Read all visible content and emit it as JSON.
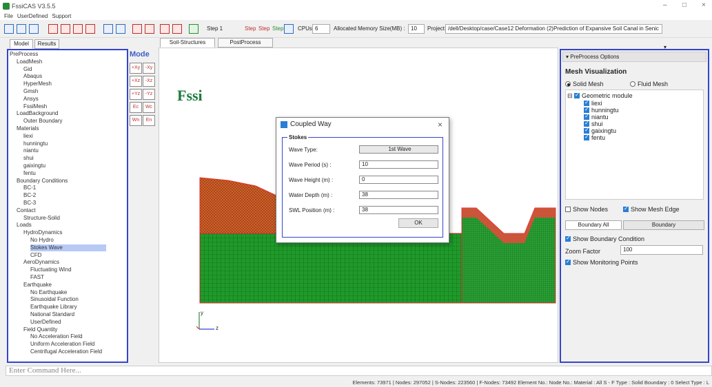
{
  "window": {
    "title": "FssiCAS V3.5.5"
  },
  "menu": [
    "File",
    "UserDefined",
    "Support"
  ],
  "toolbar": {
    "step": "Step 1",
    "step_labels": [
      "Step",
      "Step",
      "Step"
    ],
    "cpus_label": "CPUs",
    "cpus": "6",
    "mem_label": "Allocated Memory Size(MB) :",
    "mem": "10",
    "project_label": "Project:",
    "project": "/dell/Desktop/case/Case12 Deformation (2)Prediction of Expansive Soil Canal in Senic"
  },
  "left_tabs": [
    "Model",
    "Results"
  ],
  "view_tabs": [
    "Soil-Structures",
    "PostProcess"
  ],
  "tree": [
    {
      "t": "PreProcess",
      "d": 0
    },
    {
      "t": "LoadMesh",
      "d": 1
    },
    {
      "t": "Gid",
      "d": 2
    },
    {
      "t": "Abaqus",
      "d": 2
    },
    {
      "t": "HyperMesh",
      "d": 2
    },
    {
      "t": "Gmsh",
      "d": 2
    },
    {
      "t": "Ansys",
      "d": 2
    },
    {
      "t": "FssiMesh",
      "d": 2
    },
    {
      "t": "LoadBackground",
      "d": 1
    },
    {
      "t": "Outer Boundary",
      "d": 2
    },
    {
      "t": "Materials",
      "d": 1
    },
    {
      "t": "liexi",
      "d": 2
    },
    {
      "t": "hunningtu",
      "d": 2
    },
    {
      "t": "niantu",
      "d": 2
    },
    {
      "t": "shui",
      "d": 2
    },
    {
      "t": "gaixingtu",
      "d": 2
    },
    {
      "t": "fentu",
      "d": 2
    },
    {
      "t": "Boundary Conditions",
      "d": 1
    },
    {
      "t": "BC-1",
      "d": 2
    },
    {
      "t": "BC-2",
      "d": 2
    },
    {
      "t": "BC-3",
      "d": 2
    },
    {
      "t": "Contact",
      "d": 1
    },
    {
      "t": "Structure-Solid",
      "d": 2
    },
    {
      "t": "Loads",
      "d": 1
    },
    {
      "t": "HydroDynamics",
      "d": 2
    },
    {
      "t": "No Hydro",
      "d": 3
    },
    {
      "t": "Stokes Wave",
      "d": 3
    },
    {
      "t": "CFD",
      "d": 3
    },
    {
      "t": "AeroDynamics",
      "d": 2
    },
    {
      "t": "Fluctuating Wind",
      "d": 3
    },
    {
      "t": "FAST",
      "d": 3
    },
    {
      "t": "Earthquake",
      "d": 2
    },
    {
      "t": "No Earthquake",
      "d": 3
    },
    {
      "t": "Sinusoidal Function",
      "d": 3
    },
    {
      "t": "Earthquake Library",
      "d": 3
    },
    {
      "t": "National Standard",
      "d": 3
    },
    {
      "t": "UserDefined",
      "d": 3
    },
    {
      "t": "Field Quantity",
      "d": 2
    },
    {
      "t": "No Acceleration Field",
      "d": 3
    },
    {
      "t": "Uniform Acceleration Field",
      "d": 3
    },
    {
      "t": "Centrifugal Acceleration Field",
      "d": 3
    }
  ],
  "mode_label": "Mode",
  "side_buttons": [
    "+Xy",
    "-Xy",
    "+Xz",
    "-Xz",
    "+Yz",
    "-Yz",
    "Ec",
    "Wc",
    "Wn",
    "En"
  ],
  "logo": "Fssi",
  "axes": {
    "y": "y",
    "z": "z"
  },
  "dialog": {
    "title": "Coupled Way",
    "group": "Stokes",
    "fields": [
      {
        "label": "Wave Type:",
        "value": "1st Wave"
      },
      {
        "label": "Wave Period (s) :",
        "value": "10"
      },
      {
        "label": "Wave Height (m) :",
        "value": "0"
      },
      {
        "label": "Water Depth (m) :",
        "value": "38"
      },
      {
        "label": "SWL Position (m) :",
        "value": "38"
      }
    ],
    "ok": "OK",
    "close": "×"
  },
  "right": {
    "header": "PreProcess Options",
    "mesh_title": "Mesh Visualization",
    "solid": "Solid Mesh",
    "fluid": "Fluid Mesh",
    "module": "Geometric module",
    "modules": [
      "liexi",
      "hunningtu",
      "niantu",
      "shui",
      "gaixingtu",
      "fentu"
    ],
    "show_nodes": "Show Nodes",
    "show_edge": "Show Mesh Edge",
    "boundary_all": "Boundary All",
    "boundary": "Boundary",
    "show_bc": "Show Boundary Condition",
    "zoom_label": "Zoom Factor",
    "zoom": "100",
    "show_mon": "Show Monitoring Points"
  },
  "command_placeholder": "Enter Command Here...",
  "status": "Elements: 73971 | Nodes: 297052 | S-Nodes: 223560 | F-Nodes: 73492 Element No.:  Node No.:  Material : All  S - F Type : Solid  Boundary : 0  Select Type : L",
  "colors": {
    "accent": "#3344cc",
    "soil_orange": "#d2612a",
    "mesh_green": "#1f9a2a",
    "boundary_red": "#e03030"
  }
}
